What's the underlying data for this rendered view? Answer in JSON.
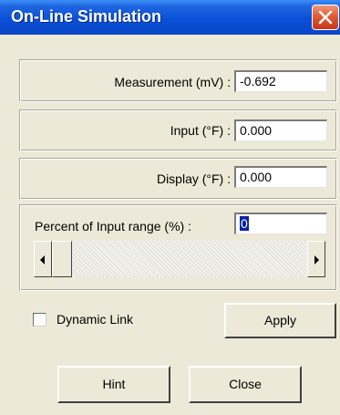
{
  "window": {
    "title": "On-Line Simulation"
  },
  "fields": {
    "measurement": {
      "label": "Measurement (mV) :",
      "value": "-0.692"
    },
    "input": {
      "label": "Input (°F) :",
      "value": "0.000"
    },
    "display": {
      "label": "Display (°F) :",
      "value": "0.000"
    },
    "percent": {
      "label": "Percent of Input range (%) :",
      "value": "0"
    }
  },
  "scrollbar": {
    "position_percent": 0
  },
  "dynamic_link": {
    "label": "Dynamic Link",
    "checked": false
  },
  "buttons": {
    "apply": "Apply",
    "hint": "Hint",
    "close": "Close"
  },
  "icons": {
    "close": "close-icon",
    "left_arrow": "arrow-left-icon",
    "right_arrow": "arrow-right-icon"
  },
  "colors": {
    "titlebar": "#0a50d8",
    "close_button": "#e05b36",
    "dialog_background": "#ece9d8",
    "selection": "#0a24a8"
  }
}
